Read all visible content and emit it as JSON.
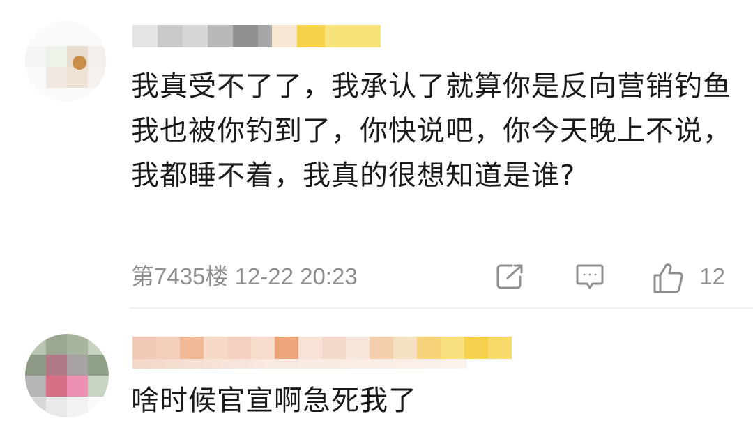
{
  "comments": [
    {
      "text": "我真受不了了，我承认了就算你是反向营销钓鱼我也被你钓到了，你快说吧，你今天晚上不说，我都睡不着，我真的很想知道是谁?",
      "floor_time": "第7435楼 12-22 20:23",
      "like_count": "12",
      "actions": [
        "share-icon",
        "comment-icon",
        "like-icon"
      ]
    },
    {
      "text": "啥时候官宣啊急死我了"
    }
  ],
  "colors": {
    "text": "#1a1a1a",
    "meta": "#8e8e8e",
    "icon": "#8e8e8e",
    "divider": "#f0f0f0"
  }
}
